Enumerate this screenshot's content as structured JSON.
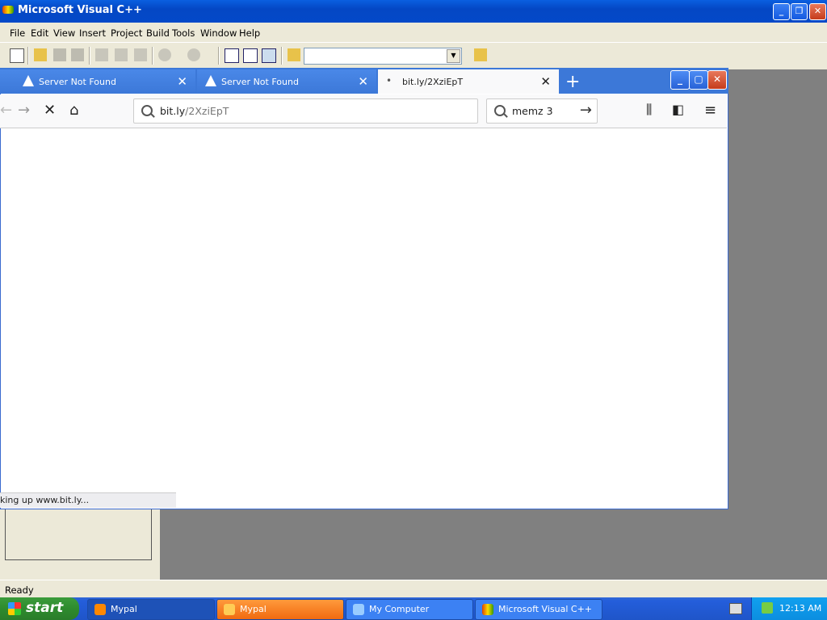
{
  "vc": {
    "title": "Microsoft Visual C++",
    "menu": [
      "File",
      "Edit",
      "View",
      "Insert",
      "Project",
      "Build",
      "Tools",
      "Window",
      "Help"
    ],
    "status": "Ready"
  },
  "browser": {
    "tabs": [
      {
        "label": "Server Not Found"
      },
      {
        "label": "Server Not Found"
      },
      {
        "label": "bit.ly/2XziEpT"
      }
    ],
    "url": {
      "host": "bit.ly",
      "path": "/2XziEpT"
    },
    "search_value": "memz 3",
    "status": "king up www.bit.ly..."
  },
  "taskbar": {
    "start_label": "start",
    "tasks": [
      "Mypal",
      "Mypal",
      "My Computer",
      "Microsoft Visual C++"
    ],
    "clock": "12:13 AM"
  }
}
